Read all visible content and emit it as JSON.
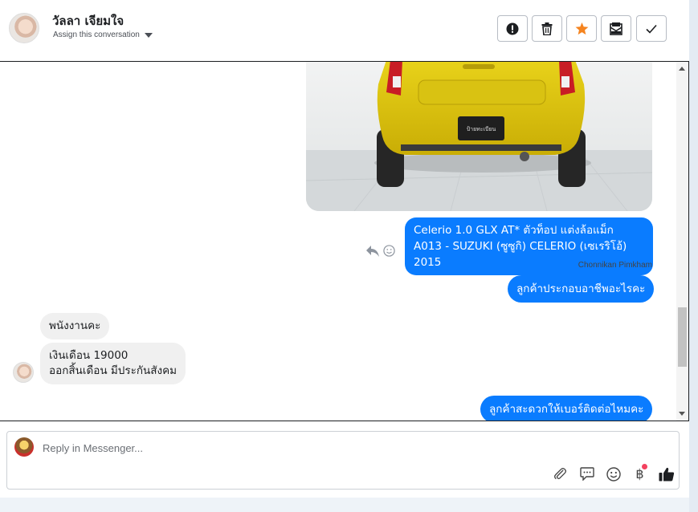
{
  "header": {
    "contact_name": "วัลลา เจียมใจ",
    "assign_label": "Assign this conversation",
    "actions": [
      {
        "name": "report-spam",
        "icon": "exclamation-icon"
      },
      {
        "name": "delete",
        "icon": "trash-icon"
      },
      {
        "name": "star",
        "icon": "star-icon"
      },
      {
        "name": "mark-unread",
        "icon": "envelope-icon"
      },
      {
        "name": "mark-done",
        "icon": "check-icon"
      }
    ]
  },
  "messages": {
    "image_plate": "ป้ายทะเบียน",
    "outgoing_1": {
      "line1": "Celerio 1.0 GLX AT* ตัวท็อป แต่งล้อแม็ก",
      "line2": "A013 - SUZUKI (ซูซูกิ) CELERIO (เซเรริโอ้) 2015"
    },
    "sender_name": "Chonnikan Pimkham",
    "outgoing_2": "ลูกค้าประกอบอาชีพอะไรคะ",
    "incoming_1": "พนังงานคะ",
    "incoming_2": {
      "line1": "เงินเดือน 19000",
      "line2": "ออกสิ้นเดือน มีประกันสังคม"
    },
    "outgoing_3": "ลูกค้าสะดวกให้เบอร์ติดต่อไหมคะ"
  },
  "composer": {
    "placeholder": "Reply in Messenger...",
    "value": "",
    "tools": [
      "paperclip-icon",
      "saved-reply-icon",
      "emoji-icon",
      "baht-payment-icon",
      "thumbs-up-icon"
    ],
    "baht_symbol": "฿"
  },
  "colors": {
    "accent": "#0a7cff",
    "star": "#f5841f",
    "incoming_bg": "#f0f0f0",
    "notification": "#f3425f"
  }
}
